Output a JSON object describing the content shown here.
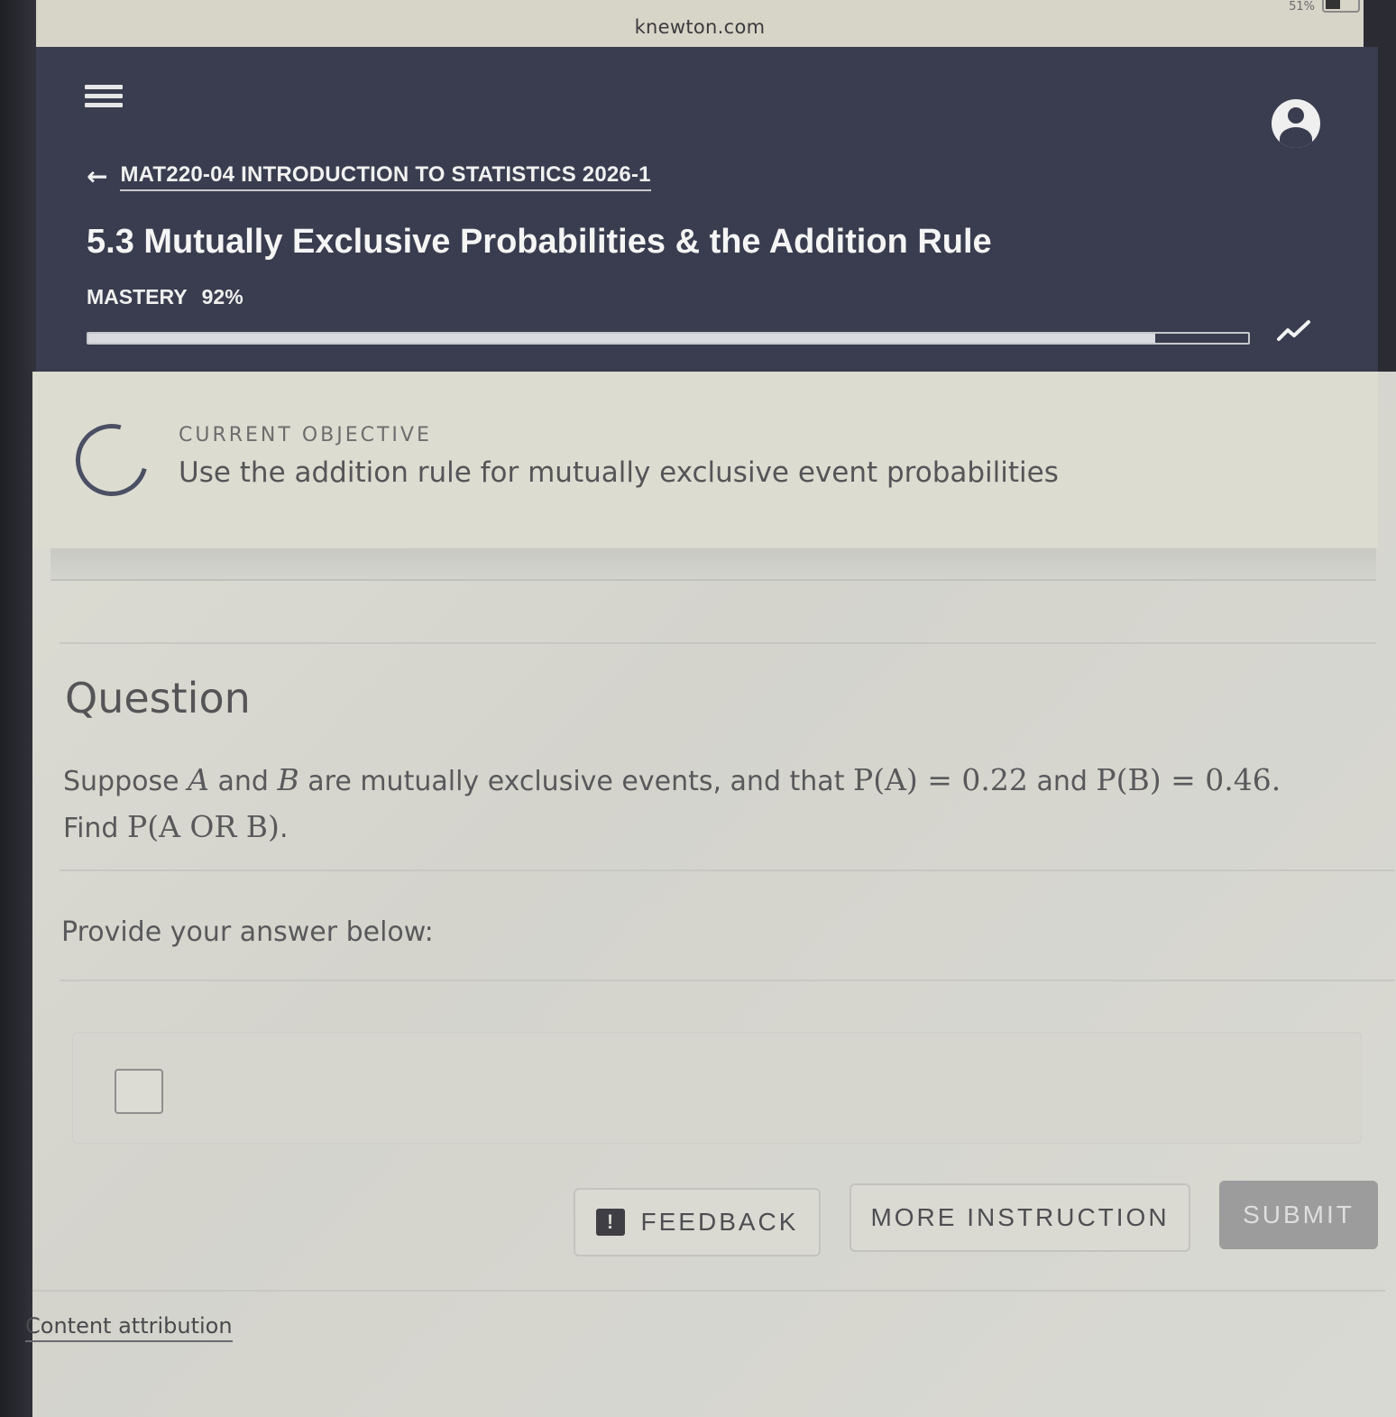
{
  "browser": {
    "url": "knewton.com",
    "battery": "51%"
  },
  "header": {
    "course_title": "MAT220-04 INTRODUCTION TO STATISTICS 2026-1",
    "page_title": "5.3 Mutually Exclusive Probabilities & the Addition Rule",
    "mastery_label": "MASTERY",
    "mastery_value": "92%",
    "mastery_progress": 0.92
  },
  "objective": {
    "label": "CURRENT OBJECTIVE",
    "text": "Use the addition rule for mutually exclusive event probabilities"
  },
  "question": {
    "heading": "Question",
    "part1": "Suppose ",
    "varA": "A",
    "and1": " and ",
    "varB": "B",
    "part2": " are mutually exclusive events, and that ",
    "pa": "P(A) = 0.22",
    "and2": " and ",
    "pb": "P(B) = 0.46",
    "period": ".",
    "find": "Find ",
    "target": "P(A OR B)",
    "end": "."
  },
  "answer": {
    "prompt": "Provide your answer below:"
  },
  "buttons": {
    "feedback": "FEEDBACK",
    "more_instruction": "MORE INSTRUCTION",
    "submit": "SUBMIT"
  },
  "footer": {
    "attribution": "Content attribution"
  },
  "colors": {
    "header_bg": "#3a3d4f",
    "content_bg": "#dcdcd3",
    "submit_bg": "#9b9c9b"
  }
}
